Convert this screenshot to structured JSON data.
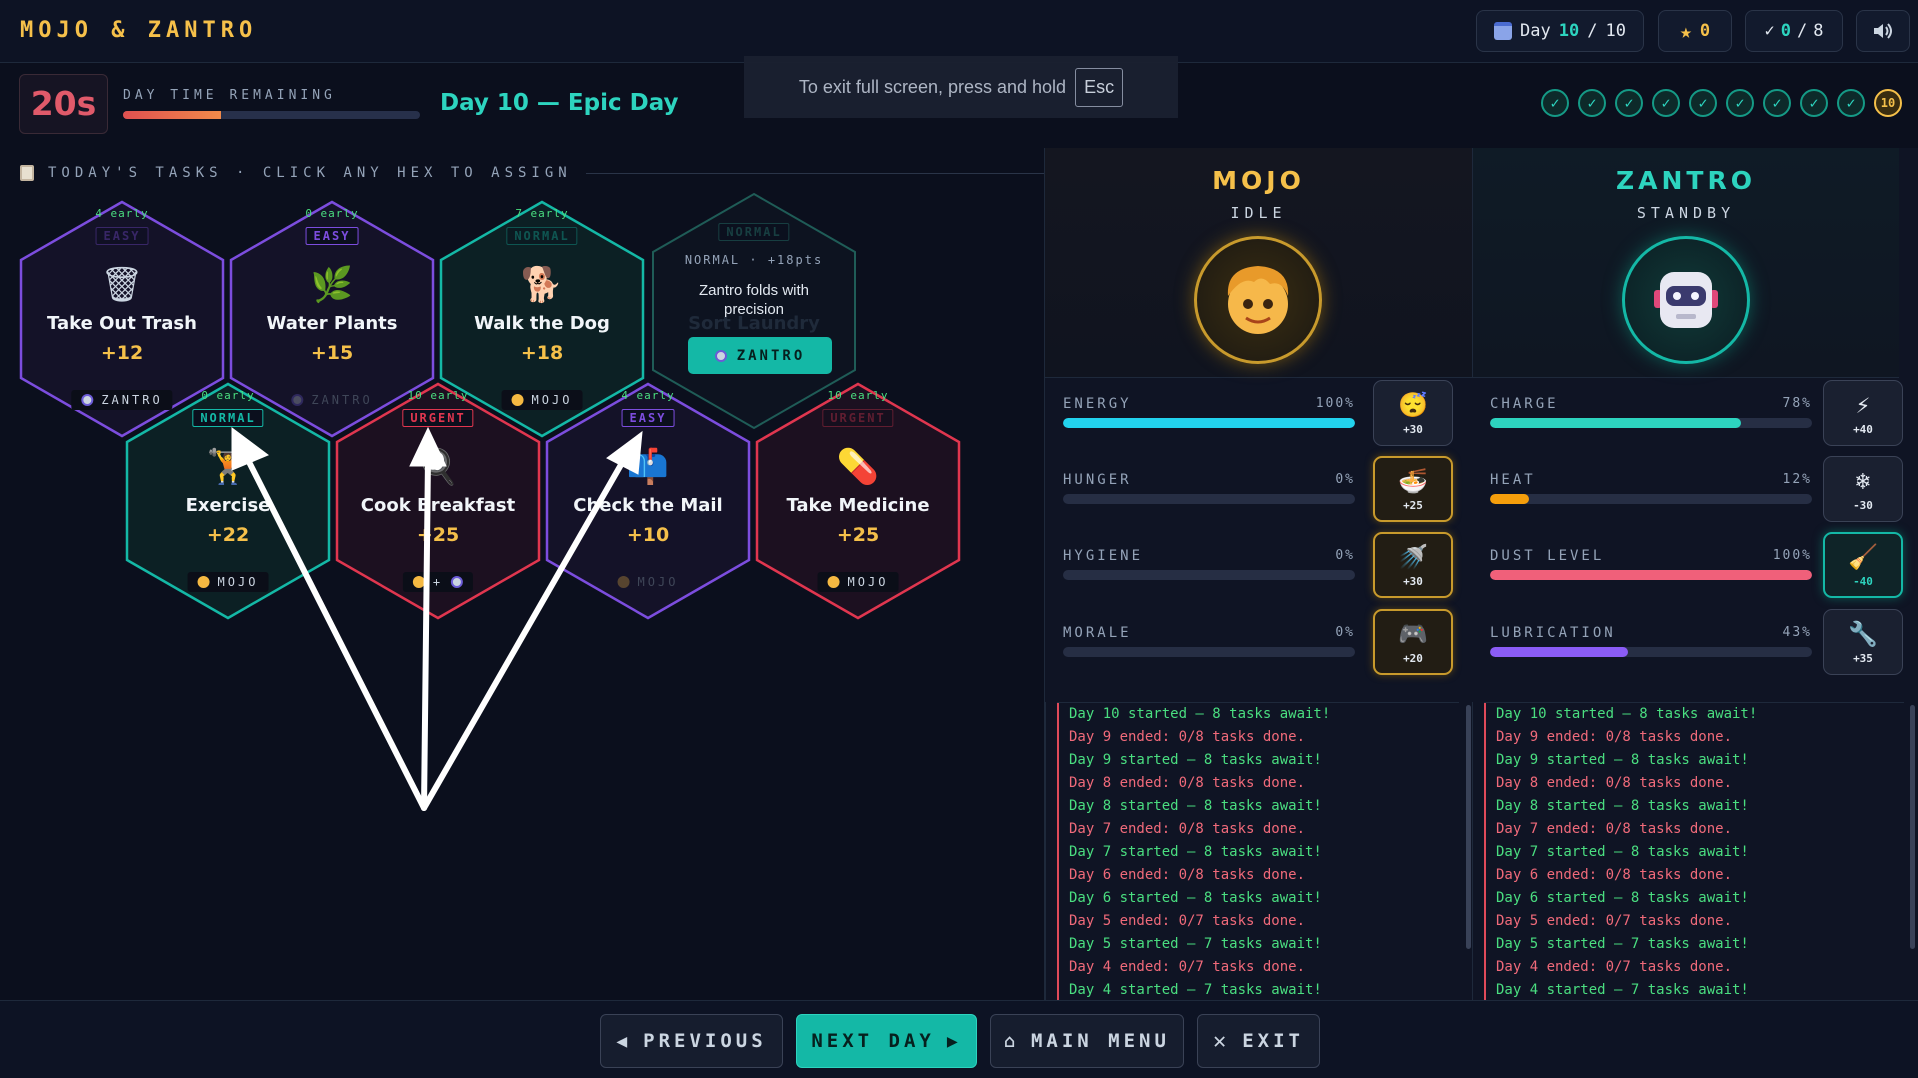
{
  "app": {
    "title": "MOJO & ZANTRO"
  },
  "topbar": {
    "day_label": "Day",
    "day_current": "10",
    "day_sep": "/",
    "day_total": "10",
    "stars": "0",
    "tasks_done": "0",
    "tasks_sep": "/",
    "tasks_total": "8"
  },
  "timer": {
    "value": "20s",
    "label": "DAY TIME REMAINING",
    "fraction_remaining": 0.33
  },
  "day_heading": "Day 10 — Epic Day",
  "fullscreen_banner": {
    "text": "To exit full screen, press and hold",
    "key": "Esc"
  },
  "day_dots": {
    "checks": [
      "✓",
      "✓",
      "✓",
      "✓",
      "✓",
      "✓",
      "✓",
      "✓",
      "✓"
    ],
    "current": "10"
  },
  "tasks_header": "TODAY'S TASKS · CLICK ANY HEX TO ASSIGN",
  "tasks": [
    {
      "name": "Take Out Trash",
      "points": "+12",
      "difficulty": "EASY",
      "early": "4 early",
      "owner": "ZANTRO",
      "icon": "trash-can-icon",
      "glyph": "🗑",
      "color": "#7c4dde",
      "dim_diff": true
    },
    {
      "name": "Water Plants",
      "points": "+15",
      "difficulty": "EASY",
      "early": "0 early",
      "owner": "ZANTRO",
      "icon": "plant-icon",
      "glyph": "🌿",
      "color": "#7c4dde",
      "dim_owner": true
    },
    {
      "name": "Walk the Dog",
      "points": "+18",
      "difficulty": "NORMAL",
      "early": "7 early",
      "owner": "MOJO",
      "icon": "dog-icon",
      "glyph": "🐕",
      "color": "#14b8a6",
      "dim_diff": true
    },
    {
      "name": "Exercise",
      "points": "+22",
      "difficulty": "NORMAL",
      "early": "0 early",
      "owner": "MOJO",
      "icon": "weightlifter-icon",
      "glyph": "🏋",
      "color": "#14b8a6"
    },
    {
      "name": "Cook Breakfast",
      "points": "+25",
      "difficulty": "URGENT",
      "early": "10 early",
      "owner": "",
      "icon": "frying-pan-icon",
      "glyph": "🍳",
      "color": "#e0364f"
    },
    {
      "name": "Check the Mail",
      "points": "+10",
      "difficulty": "EASY",
      "early": "4 early",
      "owner": "MOJO",
      "icon": "mailbox-icon",
      "glyph": "📫",
      "color": "#7c4dde",
      "dim_owner": true
    },
    {
      "name": "Take Medicine",
      "points": "+25",
      "difficulty": "URGENT",
      "early": "10 early",
      "owner": "MOJO",
      "icon": "pill-icon",
      "glyph": "💊",
      "color": "#e0364f",
      "dim_diff": true
    }
  ],
  "hover_task": {
    "meta": "NORMAL · +18pts",
    "ghost_difficulty": "NORMAL",
    "ghost_name": "Sort Laundry",
    "description": "Zantro folds with precision",
    "assign_label": "ZANTRO"
  },
  "mojo": {
    "name": "MOJO",
    "state": "IDLE",
    "stats": [
      {
        "label": "ENERGY",
        "value": "100%",
        "level": 1.0,
        "color": "#22d3ee",
        "action": "+30",
        "action_icon": "sleeping-face-icon",
        "glyph": "😴",
        "style": "act-gray"
      },
      {
        "label": "HUNGER",
        "value": "0%",
        "level": 0.0,
        "color": "#f59e0b",
        "action": "+25",
        "action_icon": "noodle-bowl-icon",
        "glyph": "🍜",
        "style": "act-gold"
      },
      {
        "label": "HYGIENE",
        "value": "0%",
        "level": 0.0,
        "color": "#38bdf8",
        "action": "+30",
        "action_icon": "shower-icon",
        "glyph": "🚿",
        "style": "act-gold"
      },
      {
        "label": "MORALE",
        "value": "0%",
        "level": 0.0,
        "color": "#a78bfa",
        "action": "+20",
        "action_icon": "game-controller-icon",
        "glyph": "🎮",
        "style": "act-gold"
      }
    ]
  },
  "zantro": {
    "name": "ZANTRO",
    "state": "STANDBY",
    "stats": [
      {
        "label": "CHARGE",
        "value": "78%",
        "level": 0.78,
        "color": "#2dd4bf",
        "action": "+40",
        "action_icon": "lightning-icon",
        "glyph": "⚡",
        "style": "act-gray"
      },
      {
        "label": "HEAT",
        "value": "12%",
        "level": 0.12,
        "color": "#f59e0b",
        "action": "-30",
        "action_icon": "snowflake-icon",
        "glyph": "❄",
        "style": "act-gray"
      },
      {
        "label": "DUST LEVEL",
        "value": "100%",
        "level": 1.0,
        "color": "#f0607a",
        "action": "-40",
        "action_icon": "broom-icon",
        "glyph": "🧹",
        "style": "act-teal"
      },
      {
        "label": "LUBRICATION",
        "value": "43%",
        "level": 0.43,
        "color": "#8b5cf6",
        "action": "+35",
        "action_icon": "wrench-icon",
        "glyph": "🔧",
        "style": "act-gray"
      }
    ]
  },
  "log_entries": [
    {
      "text": "Day 10 started — 8 tasks await!",
      "kind": "start"
    },
    {
      "text": "Day 9 ended: 0/8 tasks done.",
      "kind": "end"
    },
    {
      "text": "Day 9 started — 8 tasks await!",
      "kind": "start"
    },
    {
      "text": "Day 8 ended: 0/8 tasks done.",
      "kind": "end"
    },
    {
      "text": "Day 8 started — 8 tasks await!",
      "kind": "start"
    },
    {
      "text": "Day 7 ended: 0/8 tasks done.",
      "kind": "end"
    },
    {
      "text": "Day 7 started — 8 tasks await!",
      "kind": "start"
    },
    {
      "text": "Day 6 ended: 0/8 tasks done.",
      "kind": "end"
    },
    {
      "text": "Day 6 started — 8 tasks await!",
      "kind": "start"
    },
    {
      "text": "Day 5 ended: 0/7 tasks done.",
      "kind": "end"
    },
    {
      "text": "Day 5 started — 7 tasks await!",
      "kind": "start"
    },
    {
      "text": "Day 4 ended: 0/7 tasks done.",
      "kind": "end"
    },
    {
      "text": "Day 4 started — 7 tasks await!",
      "kind": "start"
    }
  ],
  "bottom": {
    "previous": "PREVIOUS",
    "next_day": "NEXT DAY",
    "main_menu": "MAIN MENU",
    "exit": "EXIT"
  },
  "colors": {
    "accent_teal": "#2dd4bf",
    "accent_gold": "#f5c04a",
    "urgent_red": "#e0364f",
    "easy_purple": "#7c4dde"
  }
}
